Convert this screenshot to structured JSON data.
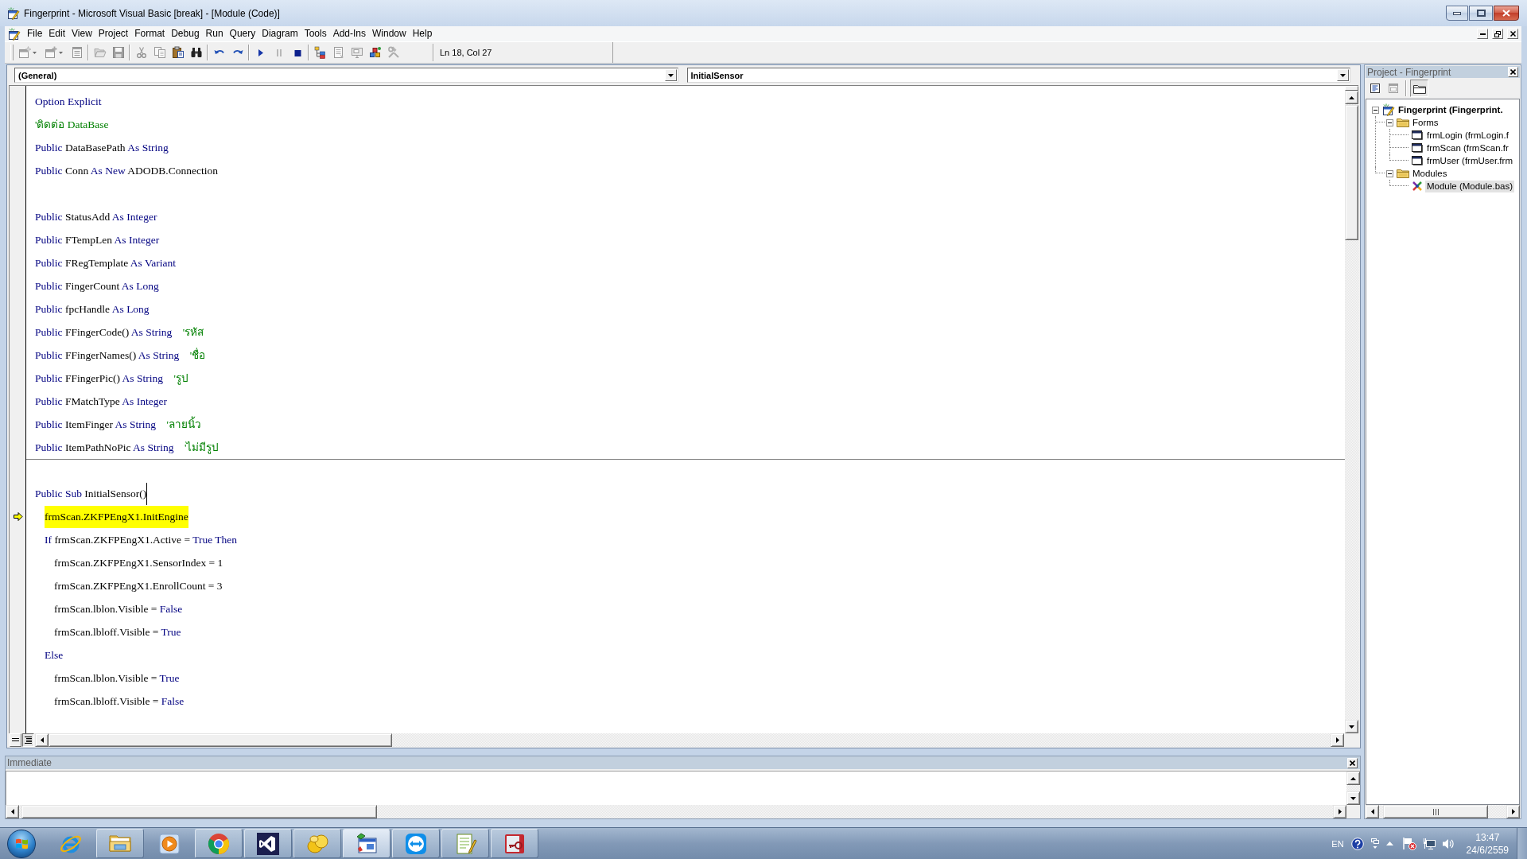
{
  "window": {
    "title": "Fingerprint - Microsoft Visual Basic [break] - [Module (Code)]"
  },
  "menu": [
    "File",
    "Edit",
    "View",
    "Project",
    "Format",
    "Debug",
    "Run",
    "Query",
    "Diagram",
    "Tools",
    "Add-Ins",
    "Window",
    "Help"
  ],
  "toolbar": {
    "groups": [
      {
        "tools": [
          {
            "kind": "add-project",
            "dropdown": true,
            "disabled": true
          },
          {
            "kind": "add-form",
            "dropdown": true,
            "disabled": true
          },
          {
            "kind": "menu-editor",
            "dropdown": false,
            "disabled": true
          }
        ]
      },
      {
        "tools": [
          {
            "kind": "open",
            "dropdown": false,
            "disabled": true
          },
          {
            "kind": "save",
            "dropdown": false,
            "disabled": true
          }
        ]
      },
      {
        "tools": [
          {
            "kind": "cut",
            "dropdown": false,
            "disabled": true
          },
          {
            "kind": "copy",
            "dropdown": false,
            "disabled": true
          },
          {
            "kind": "paste",
            "dropdown": false,
            "disabled": false
          },
          {
            "kind": "find",
            "dropdown": false,
            "disabled": false
          }
        ]
      },
      {
        "tools": [
          {
            "kind": "undo",
            "dropdown": false,
            "disabled": false
          },
          {
            "kind": "redo",
            "dropdown": false,
            "disabled": false
          }
        ]
      },
      {
        "tools": [
          {
            "kind": "run",
            "dropdown": false,
            "disabled": false
          },
          {
            "kind": "pause",
            "dropdown": false,
            "disabled": true
          },
          {
            "kind": "stop",
            "dropdown": false,
            "disabled": false
          }
        ]
      },
      {
        "tools": [
          {
            "kind": "project-explorer",
            "dropdown": false,
            "disabled": false
          },
          {
            "kind": "properties",
            "dropdown": false,
            "disabled": true
          },
          {
            "kind": "form-layout",
            "dropdown": false,
            "disabled": true
          },
          {
            "kind": "object-browser",
            "dropdown": false,
            "disabled": false
          },
          {
            "kind": "toolbox",
            "dropdown": false,
            "disabled": true
          }
        ]
      }
    ],
    "position": "Ln 18, Col 27"
  },
  "code_window": {
    "object_combo": "(General)",
    "procedure_combo": "InitialSensor",
    "sections": [
      {
        "lines": [
          {
            "kind": "code",
            "current": false,
            "caret": false,
            "segments": [
              {
                "kind": "keyword",
                "text": "Option Explicit"
              }
            ]
          },
          {
            "kind": "code",
            "current": false,
            "caret": false,
            "segments": [
              {
                "kind": "comment",
                "text": "'ติดต่อ DataBase"
              }
            ]
          },
          {
            "kind": "code",
            "current": false,
            "caret": false,
            "segments": [
              {
                "kind": "keyword",
                "text": "Public "
              },
              {
                "kind": "text",
                "text": "DataBasePath "
              },
              {
                "kind": "keyword",
                "text": "As String"
              }
            ]
          },
          {
            "kind": "code",
            "current": false,
            "caret": false,
            "segments": [
              {
                "kind": "keyword",
                "text": "Public "
              },
              {
                "kind": "text",
                "text": "Conn "
              },
              {
                "kind": "keyword",
                "text": "As New "
              },
              {
                "kind": "text",
                "text": "ADODB.Connection"
              }
            ]
          },
          {
            "kind": "blank",
            "current": false,
            "caret": false
          },
          {
            "kind": "code",
            "current": false,
            "caret": false,
            "segments": [
              {
                "kind": "keyword",
                "text": "Public "
              },
              {
                "kind": "text",
                "text": "StatusAdd "
              },
              {
                "kind": "keyword",
                "text": "As Integer"
              }
            ]
          },
          {
            "kind": "code",
            "current": false,
            "caret": false,
            "segments": [
              {
                "kind": "keyword",
                "text": "Public "
              },
              {
                "kind": "text",
                "text": "FTempLen "
              },
              {
                "kind": "keyword",
                "text": "As Integer"
              }
            ]
          },
          {
            "kind": "code",
            "current": false,
            "caret": false,
            "segments": [
              {
                "kind": "keyword",
                "text": "Public "
              },
              {
                "kind": "text",
                "text": "FRegTemplate "
              },
              {
                "kind": "keyword",
                "text": "As Variant"
              }
            ]
          },
          {
            "kind": "code",
            "current": false,
            "caret": false,
            "segments": [
              {
                "kind": "keyword",
                "text": "Public "
              },
              {
                "kind": "text",
                "text": "FingerCount "
              },
              {
                "kind": "keyword",
                "text": "As Long"
              }
            ]
          },
          {
            "kind": "code",
            "current": false,
            "caret": false,
            "segments": [
              {
                "kind": "keyword",
                "text": "Public "
              },
              {
                "kind": "text",
                "text": "fpcHandle "
              },
              {
                "kind": "keyword",
                "text": "As Long"
              }
            ]
          },
          {
            "kind": "code",
            "current": false,
            "caret": false,
            "segments": [
              {
                "kind": "keyword",
                "text": "Public "
              },
              {
                "kind": "text",
                "text": "FFingerCode() "
              },
              {
                "kind": "keyword",
                "text": "As String    "
              },
              {
                "kind": "comment",
                "text": "'รหัส"
              }
            ]
          },
          {
            "kind": "code",
            "current": false,
            "caret": false,
            "segments": [
              {
                "kind": "keyword",
                "text": "Public "
              },
              {
                "kind": "text",
                "text": "FFingerNames() "
              },
              {
                "kind": "keyword",
                "text": "As String    "
              },
              {
                "kind": "comment",
                "text": "'ชื่อ"
              }
            ]
          },
          {
            "kind": "code",
            "current": false,
            "caret": false,
            "segments": [
              {
                "kind": "keyword",
                "text": "Public "
              },
              {
                "kind": "text",
                "text": "FFingerPic() "
              },
              {
                "kind": "keyword",
                "text": "As String    "
              },
              {
                "kind": "comment",
                "text": "'รูป"
              }
            ]
          },
          {
            "kind": "code",
            "current": false,
            "caret": false,
            "segments": [
              {
                "kind": "keyword",
                "text": "Public "
              },
              {
                "kind": "text",
                "text": "FMatchType "
              },
              {
                "kind": "keyword",
                "text": "As Integer"
              }
            ]
          },
          {
            "kind": "code",
            "current": false,
            "caret": false,
            "segments": [
              {
                "kind": "keyword",
                "text": "Public "
              },
              {
                "kind": "text",
                "text": "ItemFinger "
              },
              {
                "kind": "keyword",
                "text": "As String    "
              },
              {
                "kind": "comment",
                "text": "'ลายนิ้ว"
              }
            ]
          },
          {
            "kind": "code",
            "current": false,
            "caret": false,
            "segments": [
              {
                "kind": "keyword",
                "text": "Public "
              },
              {
                "kind": "text",
                "text": "ItemPathNoPic "
              },
              {
                "kind": "keyword",
                "text": "As String    "
              },
              {
                "kind": "comment",
                "text": "'ไม่มีรูป"
              }
            ]
          }
        ]
      },
      {
        "lines": [
          {
            "kind": "blank",
            "current": false,
            "caret": false
          },
          {
            "kind": "code",
            "current": false,
            "caret": true,
            "segments": [
              {
                "kind": "keyword",
                "text": "Public Sub "
              },
              {
                "kind": "text",
                "text": "InitialSensor()"
              }
            ],
            "children": [
              {
                "kind": "code",
                "current": true,
                "caret": false,
                "segments": [
                  {
                    "kind": "text",
                    "text": "frmScan.ZKFPEngX1.InitEngine"
                  }
                ]
              },
              {
                "kind": "code",
                "current": false,
                "caret": false,
                "segments": [
                  {
                    "kind": "keyword",
                    "text": "If "
                  },
                  {
                    "kind": "text",
                    "text": "frmScan.ZKFPEngX1.Active = "
                  },
                  {
                    "kind": "keyword",
                    "text": "True Then"
                  }
                ],
                "children": [
                  {
                    "kind": "code",
                    "current": false,
                    "caret": false,
                    "segments": [
                      {
                        "kind": "text",
                        "text": "frmScan.ZKFPEngX1.SensorIndex = 1"
                      }
                    ]
                  },
                  {
                    "kind": "code",
                    "current": false,
                    "caret": false,
                    "segments": [
                      {
                        "kind": "text",
                        "text": "frmScan.ZKFPEngX1.EnrollCount = 3"
                      }
                    ]
                  },
                  {
                    "kind": "code",
                    "current": false,
                    "caret": false,
                    "segments": [
                      {
                        "kind": "text",
                        "text": "frmScan.lblon.Visible = "
                      },
                      {
                        "kind": "keyword",
                        "text": "False"
                      }
                    ]
                  },
                  {
                    "kind": "code",
                    "current": false,
                    "caret": false,
                    "segments": [
                      {
                        "kind": "text",
                        "text": "frmScan.lbloff.Visible = "
                      },
                      {
                        "kind": "keyword",
                        "text": "True"
                      }
                    ]
                  }
                ]
              },
              {
                "kind": "code",
                "current": false,
                "caret": false,
                "segments": [
                  {
                    "kind": "keyword",
                    "text": "Else"
                  }
                ],
                "children": [
                  {
                    "kind": "code",
                    "current": false,
                    "caret": false,
                    "segments": [
                      {
                        "kind": "text",
                        "text": "frmScan.lblon.Visible = "
                      },
                      {
                        "kind": "keyword",
                        "text": "True"
                      }
                    ]
                  },
                  {
                    "kind": "code",
                    "current": false,
                    "caret": false,
                    "segments": [
                      {
                        "kind": "text",
                        "text": "frmScan.lbloff.Visible = "
                      },
                      {
                        "kind": "keyword",
                        "text": "False"
                      }
                    ]
                  }
                ]
              }
            ]
          }
        ]
      }
    ],
    "views": [
      {
        "kind": "procedure",
        "selected": false
      },
      {
        "kind": "module",
        "selected": true
      }
    ]
  },
  "immediate": {
    "title": "Immediate"
  },
  "project_explorer": {
    "title": "Project - Fingerprint",
    "buttons": [
      {
        "kind": "view-code",
        "disabled": false,
        "pressed": false
      },
      {
        "kind": "view-object",
        "disabled": true,
        "pressed": false
      },
      {
        "kind": "toggle-folders",
        "disabled": false,
        "pressed": true
      }
    ],
    "tree": [
      {
        "kind": "project",
        "label": "Fingerprint (Fingerprint.",
        "expanded": true,
        "selected": false,
        "children": [
          {
            "kind": "folder",
            "label": "Forms",
            "expanded": true,
            "selected": false,
            "children": [
              {
                "kind": "form",
                "label": "frmLogin (frmLogin.f",
                "selected": false
              },
              {
                "kind": "form",
                "label": "frmScan (frmScan.fr",
                "selected": false
              },
              {
                "kind": "form",
                "label": "frmUser (frmUser.frm",
                "selected": false
              }
            ]
          },
          {
            "kind": "folder",
            "label": "Modules",
            "expanded": true,
            "selected": false,
            "children": [
              {
                "kind": "module",
                "label": "Module (Module.bas)",
                "selected": true
              }
            ]
          }
        ]
      }
    ]
  },
  "taskbar": {
    "apps": [
      {
        "kind": "internet-explorer",
        "running": false,
        "selected": false
      },
      {
        "kind": "file-explorer",
        "running": true,
        "selected": false
      },
      {
        "kind": "media-player",
        "running": false,
        "selected": false
      },
      {
        "kind": "chrome",
        "running": true,
        "selected": false
      },
      {
        "kind": "visual-studio",
        "running": true,
        "selected": false
      },
      {
        "kind": "blob-app",
        "running": true,
        "selected": false
      },
      {
        "kind": "visual-basic",
        "running": true,
        "selected": true
      },
      {
        "kind": "teamviewer",
        "running": true,
        "selected": false
      },
      {
        "kind": "notepad-plus",
        "running": true,
        "selected": false
      },
      {
        "kind": "access",
        "running": true,
        "selected": false
      }
    ],
    "language": "EN",
    "clock": {
      "time": "13:47",
      "date": "24/6/2559"
    }
  }
}
